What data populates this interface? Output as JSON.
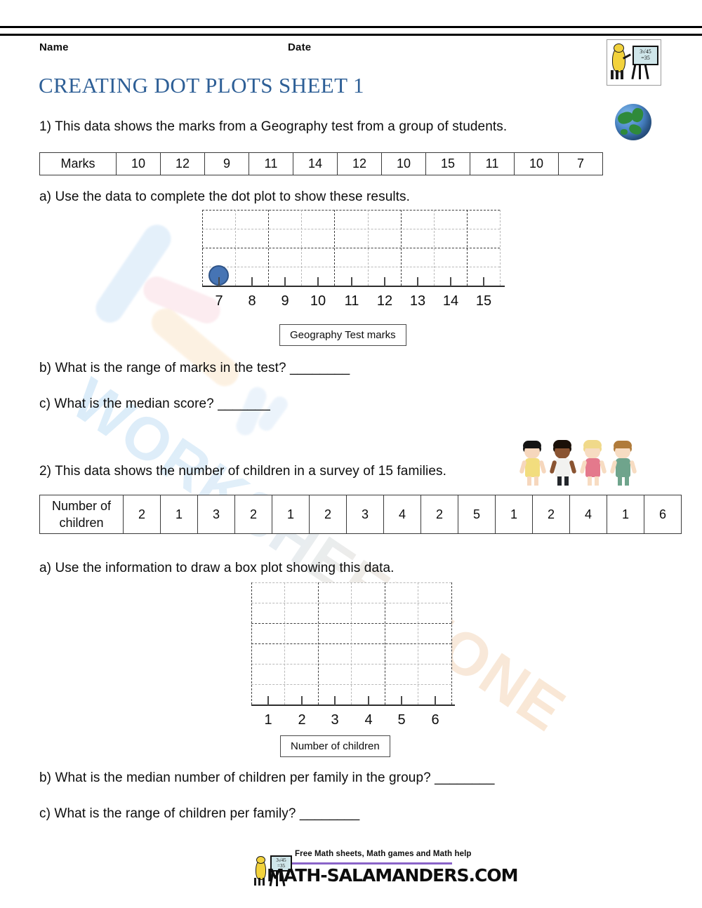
{
  "header": {
    "name_label": "Name",
    "date_label": "Date",
    "title": "CREATING DOT PLOTS SHEET 1",
    "title_color": "#2e5f96",
    "logo_icon": "salamander-blackboard-logo",
    "globe_icon": "earth-globe-icon",
    "logo_board_text": "3√45\n=35"
  },
  "watermark": {
    "text": "WORKSHEETZONE",
    "logo_icon": "worksheetzone-logo-watermark"
  },
  "q1": {
    "prompt": "1) This data shows the marks from a Geography test from a group of students.",
    "table": {
      "row_label": "Marks",
      "values": [
        "10",
        "12",
        "9",
        "11",
        "14",
        "12",
        "10",
        "15",
        "11",
        "10",
        "7"
      ]
    },
    "part_a": "a) Use the data to complete the dot plot to show these results.",
    "part_b": "b) What is the range of marks in the test? ________",
    "part_c": "c) What is the median score? _______",
    "axis_title": "Geography Test marks"
  },
  "q2": {
    "prompt": "2) This data shows the number of children in a survey of 15 families.",
    "kids_icon": "four-children-holding-hands-clipart",
    "table": {
      "row_label_line1": "Number of",
      "row_label_line2": "children",
      "values": [
        "2",
        "1",
        "3",
        "2",
        "1",
        "2",
        "3",
        "4",
        "2",
        "5",
        "1",
        "2",
        "4",
        "1",
        "6"
      ]
    },
    "part_a": "a) Use the information to draw a box plot showing this data.",
    "part_b": "b) What is the median number of children per family in the group? ________",
    "part_c": "c) What is the range of children per family? ________",
    "axis_title": "Number of children"
  },
  "footer": {
    "tagline": "Free Math sheets, Math games and Math help",
    "domain": "MATH-SALAMANDERS.COM",
    "rule_color": "#8a63c8",
    "logo_icon": "salamander-blackboard-logo"
  },
  "chart_data": [
    {
      "type": "dot",
      "id": "geography-dot-plot",
      "title": "",
      "xlabel": "Geography Test marks",
      "ylabel": "",
      "categories": [
        7,
        8,
        9,
        10,
        11,
        12,
        13,
        14,
        15
      ],
      "tick_labels": [
        "7",
        "8",
        "9",
        "10",
        "11",
        "12",
        "13",
        "14",
        "15"
      ],
      "values": [
        1,
        0,
        0,
        0,
        0,
        0,
        0,
        0,
        0
      ],
      "plotted_dots": [
        {
          "x": 7,
          "count": 1
        }
      ],
      "dot_color": "#4674b4",
      "dot_border_color": "#2f5488",
      "grid": true,
      "grid_columns": 9,
      "grid_rows": 4,
      "xlim": [
        7,
        15
      ],
      "ylim": [
        0,
        4
      ],
      "note": "Partially completed dot plot: only one dot plotted at mark 7"
    },
    {
      "type": "dot",
      "id": "children-box-plot-grid",
      "title": "",
      "xlabel": "Number of children",
      "ylabel": "",
      "categories": [
        1,
        2,
        3,
        4,
        5,
        6
      ],
      "tick_labels": [
        "1",
        "2",
        "3",
        "4",
        "5",
        "6"
      ],
      "values": [
        0,
        0,
        0,
        0,
        0,
        0
      ],
      "plotted_dots": [],
      "grid": true,
      "grid_columns": 6,
      "grid_rows": 7,
      "xlim": [
        1,
        6
      ],
      "ylim": [
        0,
        7
      ],
      "note": "Empty grid for student to draw a box plot"
    }
  ]
}
